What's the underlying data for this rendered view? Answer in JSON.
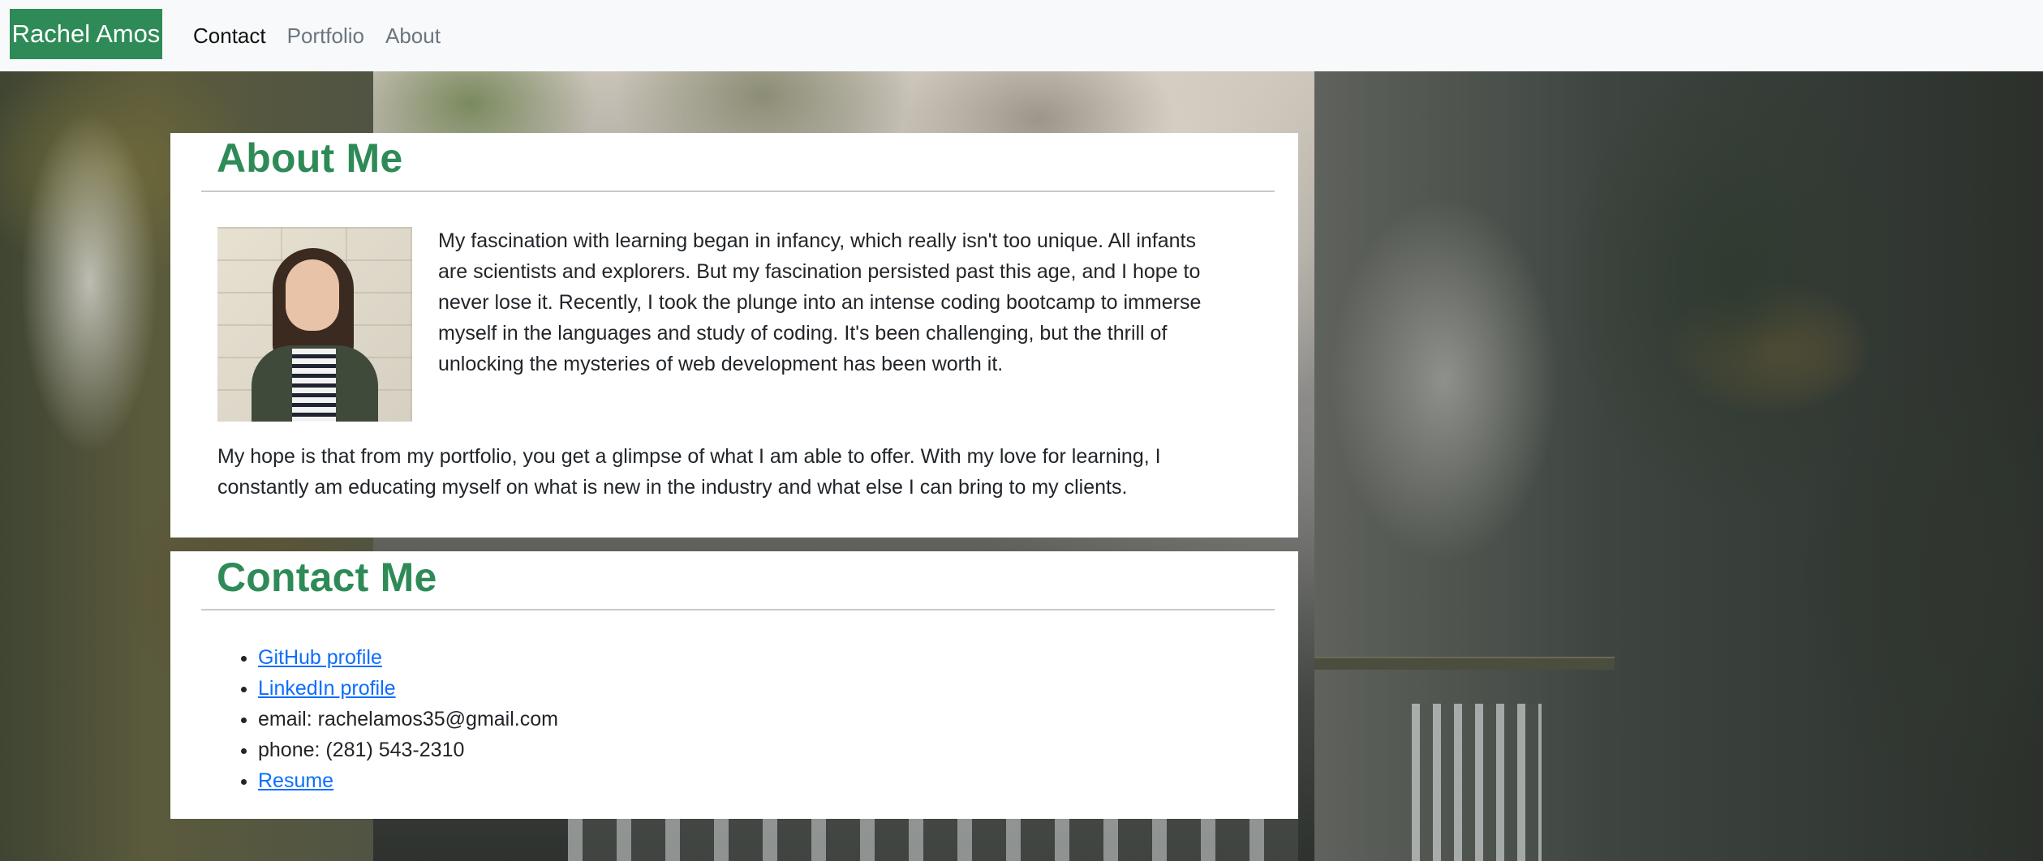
{
  "navbar": {
    "brand": "Rachel Amos",
    "links": [
      {
        "label": "Contact",
        "active": true
      },
      {
        "label": "Portfolio",
        "active": false
      },
      {
        "label": "About",
        "active": false
      }
    ]
  },
  "about": {
    "title": "About Me",
    "paragraph1": "My fascination with learning began in infancy, which really isn't too unique. All infants are scientists and explorers. But my fascination persisted past this age, and I hope to never lose it. Recently, I took the plunge into an intense coding bootcamp to immerse myself in the languages and study of coding. It's been challenging, but the thrill of unlocking the mysteries of web development has been worth it.",
    "paragraph2": "My hope is that from my portfolio, you get a glimpse of what I am able to offer. With my love for learning, I constantly am educating myself on what is new in the industry and what else I can bring to my clients."
  },
  "contact": {
    "title": "Contact Me",
    "github_label": "GitHub profile",
    "linkedin_label": "LinkedIn profile",
    "email_text": "email: rachelamos35@gmail.com",
    "phone_text": "phone: (281) 543-2310",
    "resume_label": "Resume"
  },
  "colors": {
    "brand_green": "#2e8b57",
    "link_blue": "#0d6efd",
    "navbar_bg": "#f8f9fa"
  }
}
